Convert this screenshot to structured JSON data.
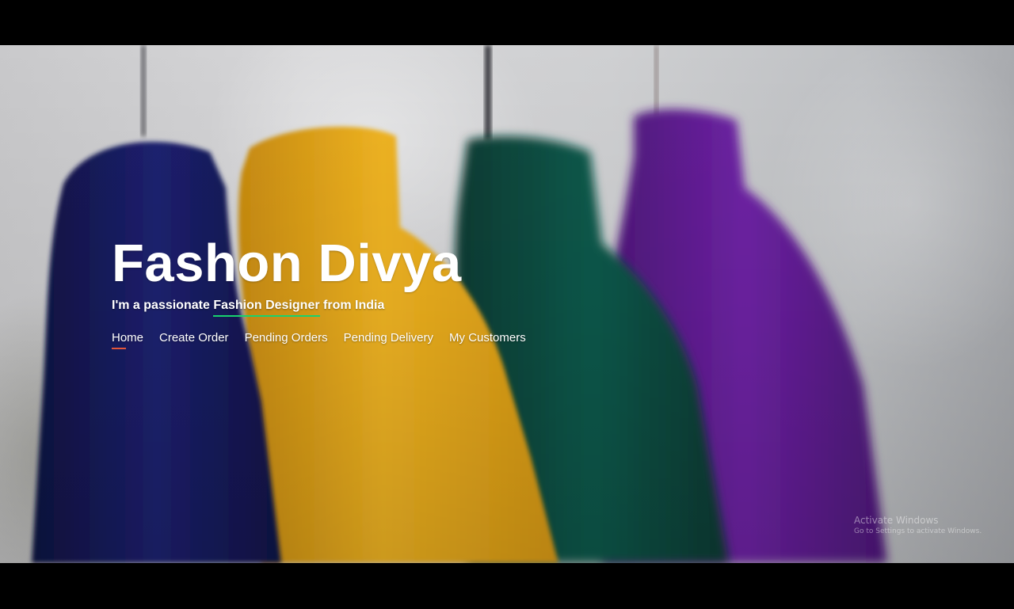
{
  "hero": {
    "title": "Fashon Divya",
    "tagline_prefix": "I'm a passionate",
    "tagline_typed": "Fashion Designer",
    "tagline_suffix": "from India"
  },
  "nav": {
    "items": [
      {
        "label": "Home",
        "active": true
      },
      {
        "label": "Create Order"
      },
      {
        "label": "Pending Orders"
      },
      {
        "label": "Pending Delivery"
      },
      {
        "label": "My Customers"
      }
    ]
  },
  "watermark": {
    "title": "Activate Windows",
    "subtitle": "Go to Settings to activate Windows."
  },
  "colors": {
    "accent_underline": "#18d26e",
    "active_nav_underline": "#e2563a",
    "navy_garment": "#15195a",
    "yellow_garment": "#e7a71a",
    "green_garment": "#0b4b40",
    "purple_garment": "#5e1e8c"
  }
}
